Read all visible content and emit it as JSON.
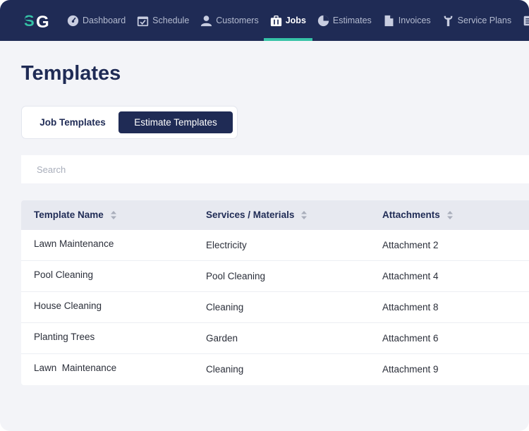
{
  "nav": {
    "items": [
      {
        "label": "Dashboard",
        "icon": "dashboard-icon"
      },
      {
        "label": "Schedule",
        "icon": "calendar-icon"
      },
      {
        "label": "Customers",
        "icon": "user-icon"
      },
      {
        "label": "Jobs",
        "icon": "briefcase-icon",
        "active": true
      },
      {
        "label": "Estimates",
        "icon": "pie-icon"
      },
      {
        "label": "Invoices",
        "icon": "document-icon"
      },
      {
        "label": "Service Plans",
        "icon": "wrench-icon"
      }
    ],
    "accent": "#35c2a6",
    "background": "#1f2b55"
  },
  "page": {
    "title": "Templates"
  },
  "tabs": {
    "job_label": "Job Templates",
    "estimate_label": "Estimate Templates",
    "selected": "Estimate Templates"
  },
  "search": {
    "placeholder": "Search",
    "value": ""
  },
  "table": {
    "columns": [
      "Template Name",
      "Services / Materials",
      "Attachments"
    ],
    "rows": [
      [
        "Lawn Maintenance",
        "Electricity",
        "Attachment 2"
      ],
      [
        "Pool Cleaning",
        "Pool Cleaning",
        "Attachment 4"
      ],
      [
        "House Cleaning",
        "Cleaning",
        "Attachment 8"
      ],
      [
        "Planting Trees",
        "Garden",
        "Attachment 6"
      ],
      [
        "Lawn  Maintenance",
        "Cleaning",
        "Attachment 9"
      ]
    ]
  }
}
